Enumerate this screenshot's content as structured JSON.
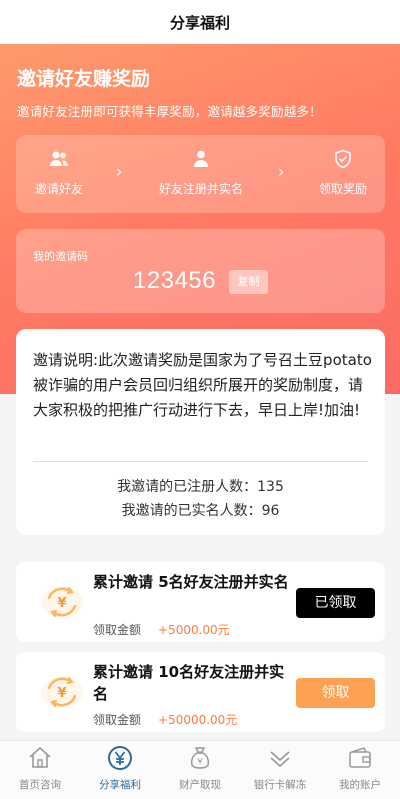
{
  "header": {
    "title": "分享福利"
  },
  "hero": {
    "title": "邀请好友赚奖励",
    "subtitle": "邀请好友注册即可获得丰厚奖励，邀请越多奖励越多！",
    "steps": [
      {
        "label": "邀请好友",
        "icon": "users-icon"
      },
      {
        "label": "好友注册并实名",
        "icon": "user-icon"
      },
      {
        "label": "领取奖励",
        "icon": "shield-check-icon"
      }
    ],
    "step_arrow": "›"
  },
  "invite_code": {
    "label": "我的邀请码",
    "value": "123456",
    "copy_label": "复制"
  },
  "info": {
    "description": "邀请说明:此次邀请奖励是国家为了号召土豆potato被诈骗的用户会员回归组织所展开的奖励制度，请大家积极的把推广行动进行下去，早日上岸!加油!",
    "registered_text": "我邀请的已注册人数：135",
    "verified_text": "我邀请的已实名人数：96"
  },
  "tasks": [
    {
      "title": "累计邀请 5名好友注册并实名",
      "amount_label": "领取金额",
      "amount": "+5000.00元",
      "button": "已领取",
      "status": "claimed"
    },
    {
      "title": "累计邀请 10名好友注册并实名",
      "amount_label": "领取金额",
      "amount": "+50000.00元",
      "button": "领取",
      "status": "available"
    }
  ],
  "tabbar": {
    "items": [
      {
        "label": "首页咨询",
        "icon": "home-icon"
      },
      {
        "label": "分享福利",
        "icon": "yen-coin-icon",
        "active": true
      },
      {
        "label": "财产取现",
        "icon": "money-bag-icon"
      },
      {
        "label": "银行卡解冻",
        "icon": "double-chevron-icon"
      },
      {
        "label": "我的账户",
        "icon": "wallet-icon"
      }
    ]
  },
  "colors": {
    "accent": "#ff7a62",
    "claim": "#ffa152",
    "amount": "#ff7b3b",
    "tab_active": "#2c6c9a"
  }
}
